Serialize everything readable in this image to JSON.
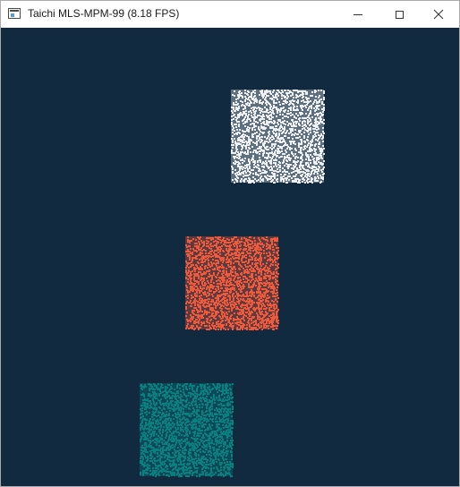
{
  "window": {
    "title": "Taichi MLS-MPM-99 (8.18 FPS)",
    "icon": "window-app-icon",
    "controls": {
      "minimize": "minimize-icon",
      "maximize": "maximize-icon",
      "close": "close-icon"
    }
  },
  "canvas": {
    "background": "#112a40",
    "blocks": [
      {
        "name": "white-particle-block",
        "color": "#eef0f2",
        "density": 0.55
      },
      {
        "name": "orange-particle-block",
        "color": "#ed5a3c",
        "density": 0.62
      },
      {
        "name": "teal-particle-block",
        "color": "#078080",
        "density": 0.6
      }
    ]
  }
}
